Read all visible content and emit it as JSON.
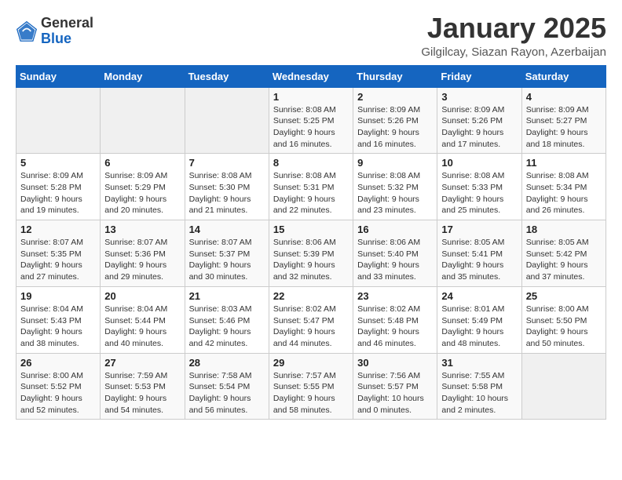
{
  "header": {
    "logo_general": "General",
    "logo_blue": "Blue",
    "title": "January 2025",
    "subtitle": "Gilgilcay, Siazan Rayon, Azerbaijan"
  },
  "weekdays": [
    "Sunday",
    "Monday",
    "Tuesday",
    "Wednesday",
    "Thursday",
    "Friday",
    "Saturday"
  ],
  "weeks": [
    [
      {
        "day": "",
        "info": ""
      },
      {
        "day": "",
        "info": ""
      },
      {
        "day": "",
        "info": ""
      },
      {
        "day": "1",
        "info": "Sunrise: 8:08 AM\nSunset: 5:25 PM\nDaylight: 9 hours\nand 16 minutes."
      },
      {
        "day": "2",
        "info": "Sunrise: 8:09 AM\nSunset: 5:26 PM\nDaylight: 9 hours\nand 16 minutes."
      },
      {
        "day": "3",
        "info": "Sunrise: 8:09 AM\nSunset: 5:26 PM\nDaylight: 9 hours\nand 17 minutes."
      },
      {
        "day": "4",
        "info": "Sunrise: 8:09 AM\nSunset: 5:27 PM\nDaylight: 9 hours\nand 18 minutes."
      }
    ],
    [
      {
        "day": "5",
        "info": "Sunrise: 8:09 AM\nSunset: 5:28 PM\nDaylight: 9 hours\nand 19 minutes."
      },
      {
        "day": "6",
        "info": "Sunrise: 8:09 AM\nSunset: 5:29 PM\nDaylight: 9 hours\nand 20 minutes."
      },
      {
        "day": "7",
        "info": "Sunrise: 8:08 AM\nSunset: 5:30 PM\nDaylight: 9 hours\nand 21 minutes."
      },
      {
        "day": "8",
        "info": "Sunrise: 8:08 AM\nSunset: 5:31 PM\nDaylight: 9 hours\nand 22 minutes."
      },
      {
        "day": "9",
        "info": "Sunrise: 8:08 AM\nSunset: 5:32 PM\nDaylight: 9 hours\nand 23 minutes."
      },
      {
        "day": "10",
        "info": "Sunrise: 8:08 AM\nSunset: 5:33 PM\nDaylight: 9 hours\nand 25 minutes."
      },
      {
        "day": "11",
        "info": "Sunrise: 8:08 AM\nSunset: 5:34 PM\nDaylight: 9 hours\nand 26 minutes."
      }
    ],
    [
      {
        "day": "12",
        "info": "Sunrise: 8:07 AM\nSunset: 5:35 PM\nDaylight: 9 hours\nand 27 minutes."
      },
      {
        "day": "13",
        "info": "Sunrise: 8:07 AM\nSunset: 5:36 PM\nDaylight: 9 hours\nand 29 minutes."
      },
      {
        "day": "14",
        "info": "Sunrise: 8:07 AM\nSunset: 5:37 PM\nDaylight: 9 hours\nand 30 minutes."
      },
      {
        "day": "15",
        "info": "Sunrise: 8:06 AM\nSunset: 5:39 PM\nDaylight: 9 hours\nand 32 minutes."
      },
      {
        "day": "16",
        "info": "Sunrise: 8:06 AM\nSunset: 5:40 PM\nDaylight: 9 hours\nand 33 minutes."
      },
      {
        "day": "17",
        "info": "Sunrise: 8:05 AM\nSunset: 5:41 PM\nDaylight: 9 hours\nand 35 minutes."
      },
      {
        "day": "18",
        "info": "Sunrise: 8:05 AM\nSunset: 5:42 PM\nDaylight: 9 hours\nand 37 minutes."
      }
    ],
    [
      {
        "day": "19",
        "info": "Sunrise: 8:04 AM\nSunset: 5:43 PM\nDaylight: 9 hours\nand 38 minutes."
      },
      {
        "day": "20",
        "info": "Sunrise: 8:04 AM\nSunset: 5:44 PM\nDaylight: 9 hours\nand 40 minutes."
      },
      {
        "day": "21",
        "info": "Sunrise: 8:03 AM\nSunset: 5:46 PM\nDaylight: 9 hours\nand 42 minutes."
      },
      {
        "day": "22",
        "info": "Sunrise: 8:02 AM\nSunset: 5:47 PM\nDaylight: 9 hours\nand 44 minutes."
      },
      {
        "day": "23",
        "info": "Sunrise: 8:02 AM\nSunset: 5:48 PM\nDaylight: 9 hours\nand 46 minutes."
      },
      {
        "day": "24",
        "info": "Sunrise: 8:01 AM\nSunset: 5:49 PM\nDaylight: 9 hours\nand 48 minutes."
      },
      {
        "day": "25",
        "info": "Sunrise: 8:00 AM\nSunset: 5:50 PM\nDaylight: 9 hours\nand 50 minutes."
      }
    ],
    [
      {
        "day": "26",
        "info": "Sunrise: 8:00 AM\nSunset: 5:52 PM\nDaylight: 9 hours\nand 52 minutes."
      },
      {
        "day": "27",
        "info": "Sunrise: 7:59 AM\nSunset: 5:53 PM\nDaylight: 9 hours\nand 54 minutes."
      },
      {
        "day": "28",
        "info": "Sunrise: 7:58 AM\nSunset: 5:54 PM\nDaylight: 9 hours\nand 56 minutes."
      },
      {
        "day": "29",
        "info": "Sunrise: 7:57 AM\nSunset: 5:55 PM\nDaylight: 9 hours\nand 58 minutes."
      },
      {
        "day": "30",
        "info": "Sunrise: 7:56 AM\nSunset: 5:57 PM\nDaylight: 10 hours\nand 0 minutes."
      },
      {
        "day": "31",
        "info": "Sunrise: 7:55 AM\nSunset: 5:58 PM\nDaylight: 10 hours\nand 2 minutes."
      },
      {
        "day": "",
        "info": ""
      }
    ]
  ]
}
